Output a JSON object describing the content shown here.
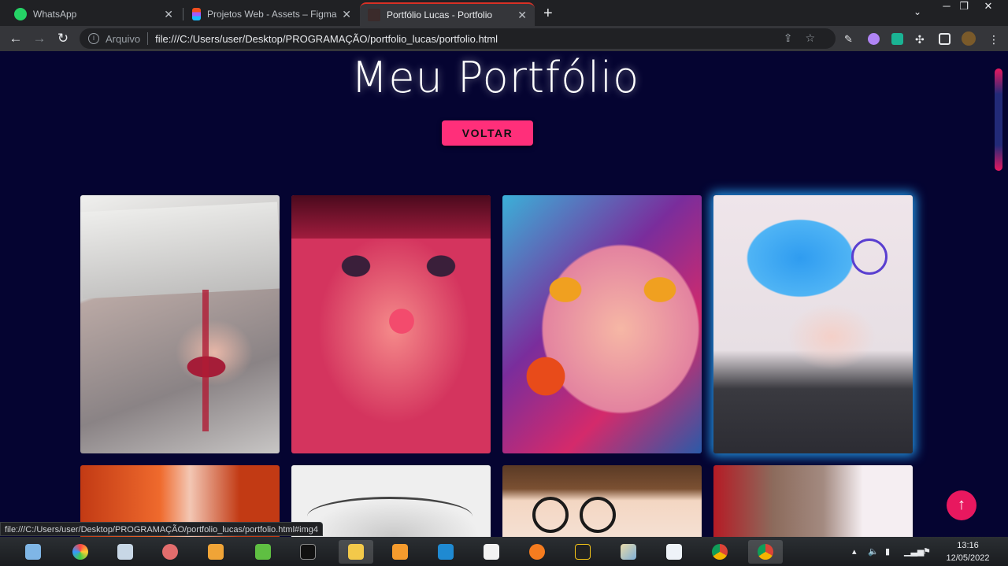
{
  "browser": {
    "tabs": [
      {
        "label": "WhatsApp",
        "active": false
      },
      {
        "label": "Projetos Web - Assets – Figma",
        "active": false
      },
      {
        "label": "Portfólio Lucas - Portfolio",
        "active": true
      }
    ],
    "address_label": "Arquivo",
    "url": "file:///C:/Users/user/Desktop/PROGRAMAÇÃO/portfolio_lucas/portfolio.html",
    "status_link": "file:///C:/Users/user/Desktop/PROGRAMAÇÃO/portfolio_lucas/portfolio.html#img4"
  },
  "page": {
    "title": "Meu Portfólio",
    "back_button": "VOLTAR",
    "accent_color": "#ff2f7a",
    "background_color": "#050431",
    "gallery": [
      {
        "name": "img1"
      },
      {
        "name": "img2"
      },
      {
        "name": "img3"
      },
      {
        "name": "img4",
        "hovered": true
      },
      {
        "name": "img5"
      },
      {
        "name": "img6"
      },
      {
        "name": "img7"
      },
      {
        "name": "img8"
      }
    ]
  },
  "taskbar": {
    "time": "13:16",
    "date": "12/05/2022"
  }
}
